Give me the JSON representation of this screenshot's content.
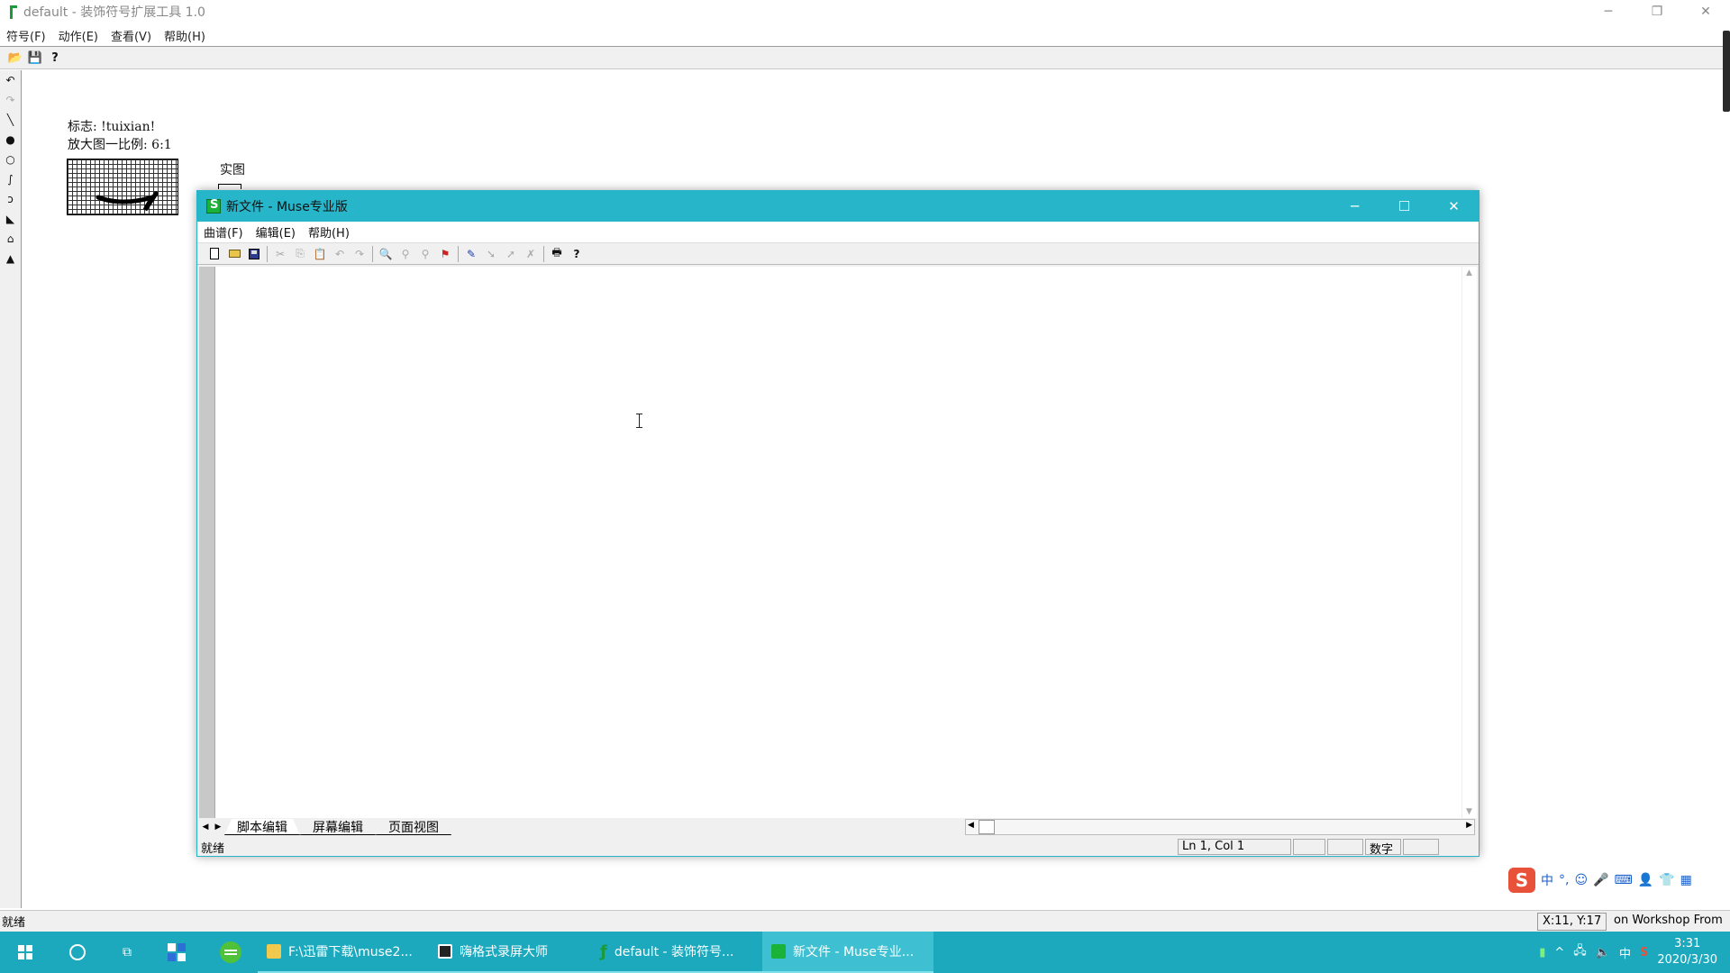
{
  "main_window": {
    "title": "default - 装饰符号扩展工具 1.0",
    "controls": {
      "minimize": "─",
      "restore": "❐",
      "close": "✕"
    },
    "menu": [
      "符号(F)",
      "动作(E)",
      "查看(V)",
      "帮助(H)"
    ],
    "toolbar_icons": [
      "open-icon",
      "save-icon",
      "help-icon"
    ],
    "left_tools": [
      "undo-icon",
      "redo-icon",
      "line-tool-icon",
      "filled-circle-icon",
      "circle-icon",
      "curve-icon",
      "curve2-icon",
      "fill-icon",
      "eraser-icon",
      "mark-icon"
    ],
    "canvas": {
      "flag_label": "标志: !tuixian!",
      "scale_label": "放大图一比例: 6:1",
      "real_label": "实图"
    },
    "status": {
      "left": "就绪",
      "coords": "X:11, Y:17",
      "extra": "on Workshop From"
    }
  },
  "muse_window": {
    "title": "新文件 - Muse专业版",
    "controls": {
      "minimize": "─",
      "maximize": "☐",
      "close": "✕"
    },
    "menu": [
      "曲谱(F)",
      "编辑(E)",
      "帮助(H)"
    ],
    "tabs": [
      "脚本编辑",
      "屏幕编辑",
      "页面视图"
    ],
    "status": {
      "left": "就绪",
      "position": "Ln 1, Col 1",
      "mode": "数字"
    }
  },
  "ime": {
    "items": [
      "中",
      "°,",
      "☺",
      "🎤",
      "⌨",
      "👤",
      "👕",
      "▦"
    ]
  },
  "taskbar": {
    "apps": [
      {
        "label": "F:\\迅雷下载\\muse2...",
        "active": false
      },
      {
        "label": "嗨格式录屏大师",
        "active": false
      },
      {
        "label": "default - 装饰符号...",
        "active": false
      },
      {
        "label": "新文件 - Muse专业...",
        "active": true
      }
    ],
    "tray": {
      "ime_lang": "中",
      "time": "3:31",
      "date": "2020/3/30"
    }
  },
  "colors": {
    "muse_title_bg": "#26b5c9",
    "taskbar_bg": "#1ca9be",
    "app_icon_green": "#1a9a3a"
  }
}
